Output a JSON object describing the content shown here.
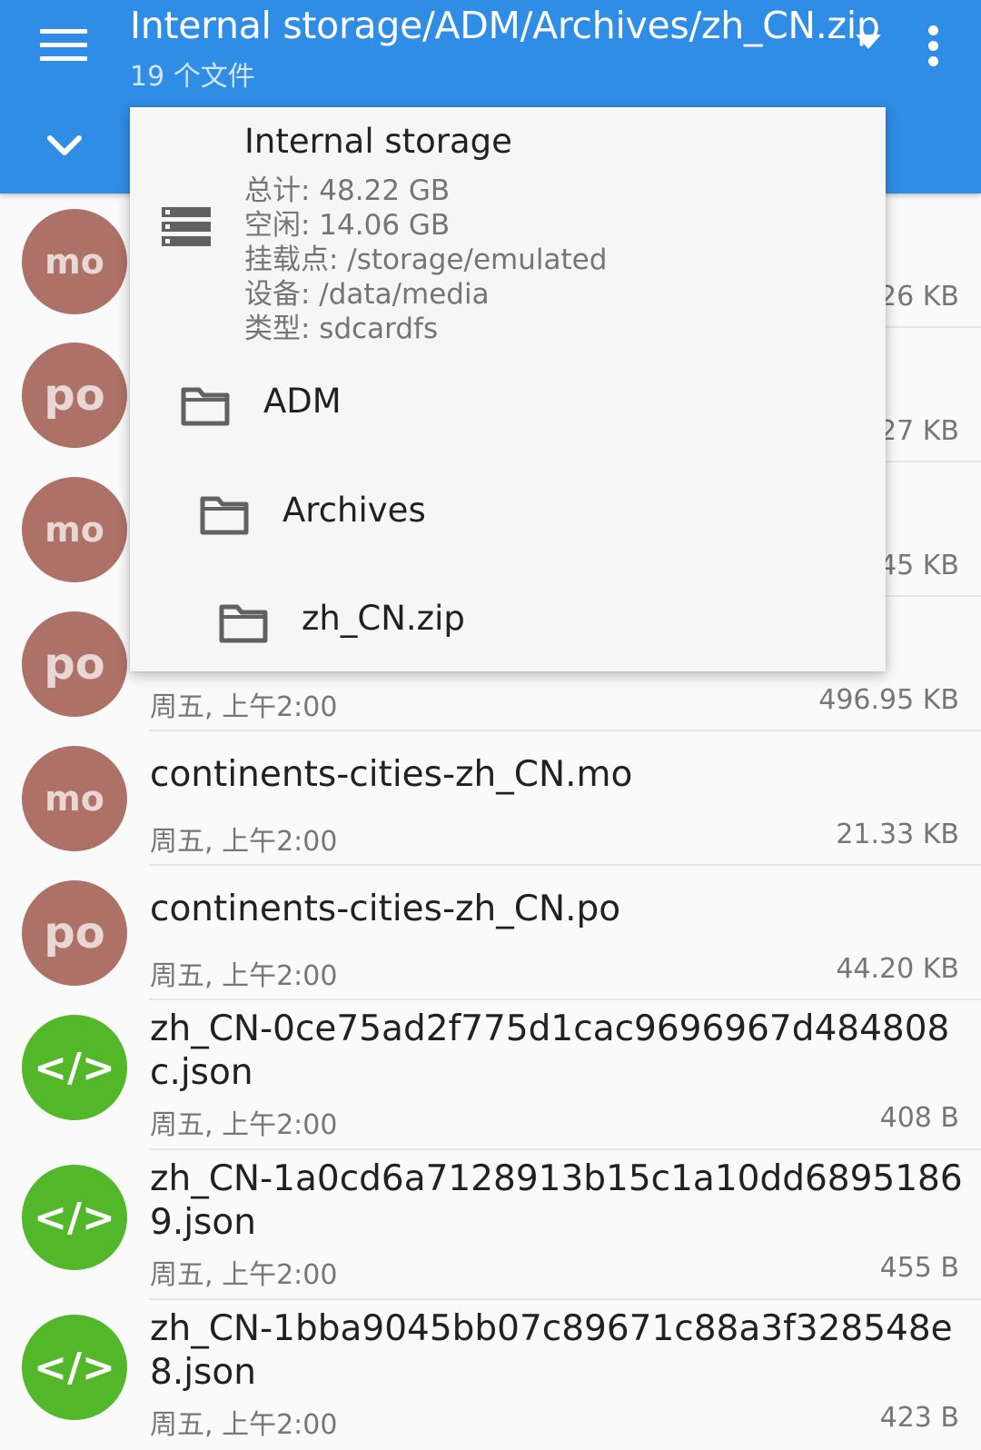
{
  "appbar": {
    "menu_icon": "hamburger-menu-icon",
    "title": "Internal storage/ADM/Archives/zh_CN.zip",
    "subtitle": "19 个文件",
    "dropdown_icon": "caret-down-icon",
    "overflow_icon": "more-vert-icon",
    "expand_icon": "chevron-down-icon",
    "color": "#2f8de6"
  },
  "popup": {
    "storage": {
      "icon": "storage-icon",
      "name": "Internal storage",
      "total": "总计: 48.22 GB",
      "free": "空闲: 14.06 GB",
      "mount": "挂载点: /storage/emulated",
      "device": "设备: /data/media",
      "type": "类型: sdcardfs"
    },
    "crumbs": [
      {
        "label": "ADM",
        "icon": "folder-icon"
      },
      {
        "label": "Archives",
        "icon": "folder-icon"
      },
      {
        "label": "zh_CN.zip",
        "icon": "folder-icon"
      }
    ]
  },
  "files": [
    {
      "avatar": "mo",
      "name": "",
      "date": "",
      "size": "26 KB"
    },
    {
      "avatar": "po",
      "name": "",
      "date": "",
      "size": "27 KB"
    },
    {
      "avatar": "mo",
      "name": "",
      "date": "",
      "size": "45 KB"
    },
    {
      "avatar": "po",
      "name": "",
      "date": "周五, 上午2:00",
      "size": "496.95 KB"
    },
    {
      "avatar": "mo",
      "name": "continents-cities-zh_CN.mo",
      "date": "周五, 上午2:00",
      "size": "21.33 KB"
    },
    {
      "avatar": "po",
      "name": "continents-cities-zh_CN.po",
      "date": "周五, 上午2:00",
      "size": "44.20 KB"
    },
    {
      "avatar": "</>",
      "name": "zh_CN-0ce75ad2f775d1cac9696967d484808c.json",
      "date": "周五, 上午2:00",
      "size": "408 B"
    },
    {
      "avatar": "</>",
      "name": "zh_CN-1a0cd6a7128913b15c1a10dd68951869.json",
      "date": "周五, 上午2:00",
      "size": "455 B"
    },
    {
      "avatar": "</>",
      "name": "zh_CN-1bba9045bb07c89671c88a3f328548e8.json",
      "date": "周五, 上午2:00",
      "size": "423 B"
    }
  ],
  "colors": {
    "mo_po_avatar": "#ad7167",
    "json_avatar": "#52b82a"
  }
}
